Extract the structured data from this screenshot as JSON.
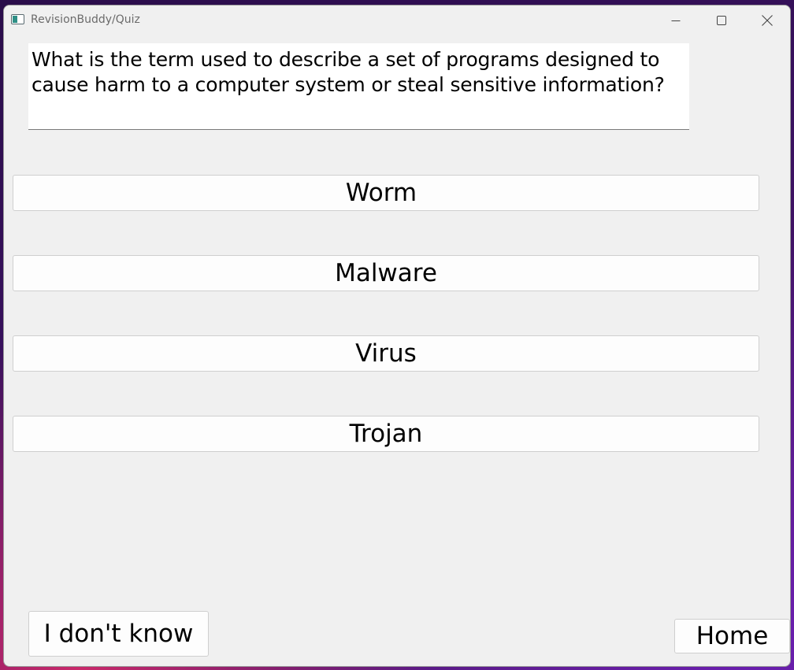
{
  "window": {
    "title": "RevisionBuddy/Quiz",
    "icons": {
      "app": "app-window-icon",
      "minimize": "minimize-icon",
      "maximize": "maximize-icon",
      "close": "close-icon"
    }
  },
  "question": {
    "text": "What is the term used to describe a set of programs designed to cause harm to a computer system or steal sensitive information?"
  },
  "answers": [
    {
      "label": "Worm"
    },
    {
      "label": "Malware"
    },
    {
      "label": "Virus"
    },
    {
      "label": "Trojan"
    }
  ],
  "footer": {
    "dont_know_label": "I don't know",
    "home_label": "Home"
  },
  "colors": {
    "window_bg": "#f0f0f0",
    "button_bg": "#fdfdfd",
    "text": "#000000"
  }
}
